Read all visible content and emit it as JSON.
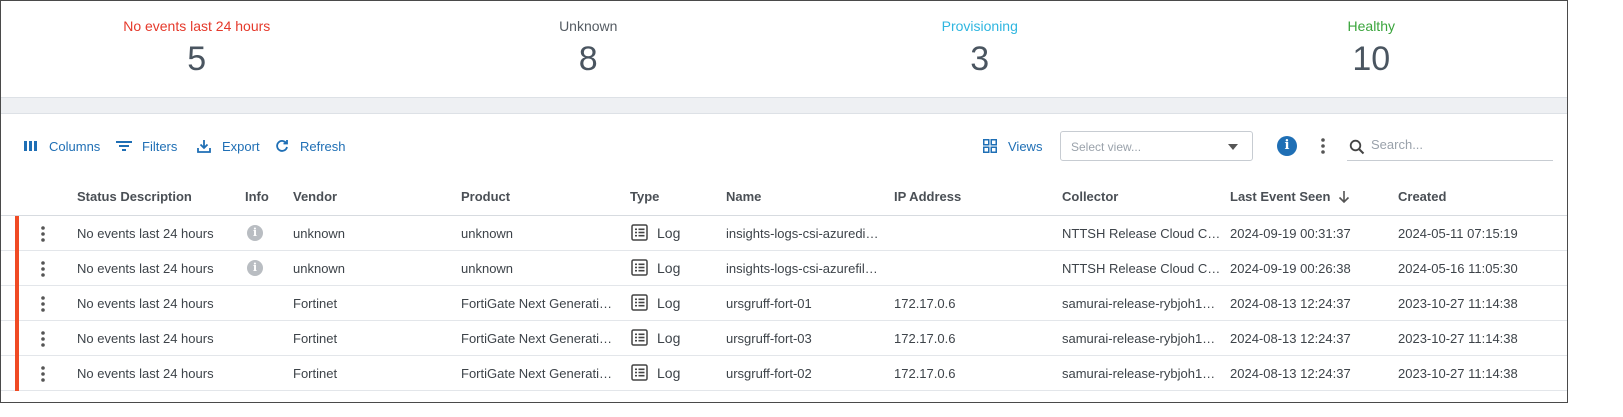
{
  "summary": [
    {
      "label": "No events last 24 hours",
      "count": "5",
      "color": "#e5392b"
    },
    {
      "label": "Unknown",
      "count": "8",
      "color": "#555c63"
    },
    {
      "label": "Provisioning",
      "count": "3",
      "color": "#2fb6e0"
    },
    {
      "label": "Healthy",
      "count": "10",
      "color": "#3aa53c"
    }
  ],
  "toolbar": {
    "columns": "Columns",
    "filters": "Filters",
    "export": "Export",
    "refresh": "Refresh",
    "views": "Views",
    "select_view_placeholder": "Select view...",
    "search_placeholder": "Search..."
  },
  "table": {
    "headers": {
      "status": "Status Description",
      "info": "Info",
      "vendor": "Vendor",
      "product": "Product",
      "type": "Type",
      "name": "Name",
      "ip": "IP Address",
      "collector": "Collector",
      "last_event": "Last Event Seen",
      "created": "Created"
    },
    "rows": [
      {
        "status": "No events last 24 hours",
        "info": true,
        "vendor": "unknown",
        "product": "unknown",
        "type": "Log",
        "name": "insights-logs-csi-azuredi…",
        "ip": "",
        "collector": "NTTSH Release Cloud C…",
        "last_event": "2024-09-19 00:31:37",
        "created": "2024-05-11 07:15:19"
      },
      {
        "status": "No events last 24 hours",
        "info": true,
        "vendor": "unknown",
        "product": "unknown",
        "type": "Log",
        "name": "insights-logs-csi-azurefil…",
        "ip": "",
        "collector": "NTTSH Release Cloud C…",
        "last_event": "2024-09-19 00:26:38",
        "created": "2024-05-16 11:05:30"
      },
      {
        "status": "No events last 24 hours",
        "info": false,
        "vendor": "Fortinet",
        "product": "FortiGate Next Generati…",
        "type": "Log",
        "name": "ursgruff-fort-01",
        "ip": "172.17.0.6",
        "collector": "samurai-release-rybjoh1…",
        "last_event": "2024-08-13 12:24:37",
        "created": "2023-10-27 11:14:38"
      },
      {
        "status": "No events last 24 hours",
        "info": false,
        "vendor": "Fortinet",
        "product": "FortiGate Next Generati…",
        "type": "Log",
        "name": "ursgruff-fort-03",
        "ip": "172.17.0.6",
        "collector": "samurai-release-rybjoh1…",
        "last_event": "2024-08-13 12:24:37",
        "created": "2023-10-27 11:14:38"
      },
      {
        "status": "No events last 24 hours",
        "info": false,
        "vendor": "Fortinet",
        "product": "FortiGate Next Generati…",
        "type": "Log",
        "name": "ursgruff-fort-02",
        "ip": "172.17.0.6",
        "collector": "samurai-release-rybjoh1…",
        "last_event": "2024-08-13 12:24:37",
        "created": "2023-10-27 11:14:38"
      }
    ]
  },
  "colors": {
    "accent": "#1f6fb5",
    "status_flag": "#f04a24"
  }
}
